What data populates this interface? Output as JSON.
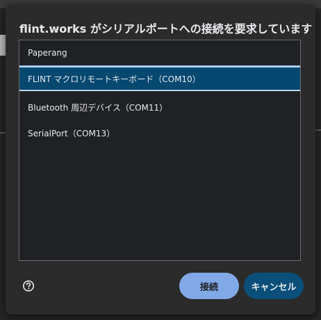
{
  "dialog": {
    "title": "flint.works がシリアルポートへの接続を要求しています",
    "devices": [
      {
        "label": "Paperang",
        "selected": false
      },
      {
        "label": "FLINT マクロリモートキーボード（COM10）",
        "selected": true
      },
      {
        "label": "Bluetooth 周辺デバイス（COM11）",
        "selected": false
      },
      {
        "label": "SerialPort（COM13）",
        "selected": false
      }
    ],
    "help_icon": "help-circle-icon",
    "connect_label": "接続",
    "cancel_label": "キャンセル"
  },
  "colors": {
    "selected_row": "#054870",
    "connect_button": "#8ab4f8",
    "cancel_button": "#0a4f7a"
  }
}
